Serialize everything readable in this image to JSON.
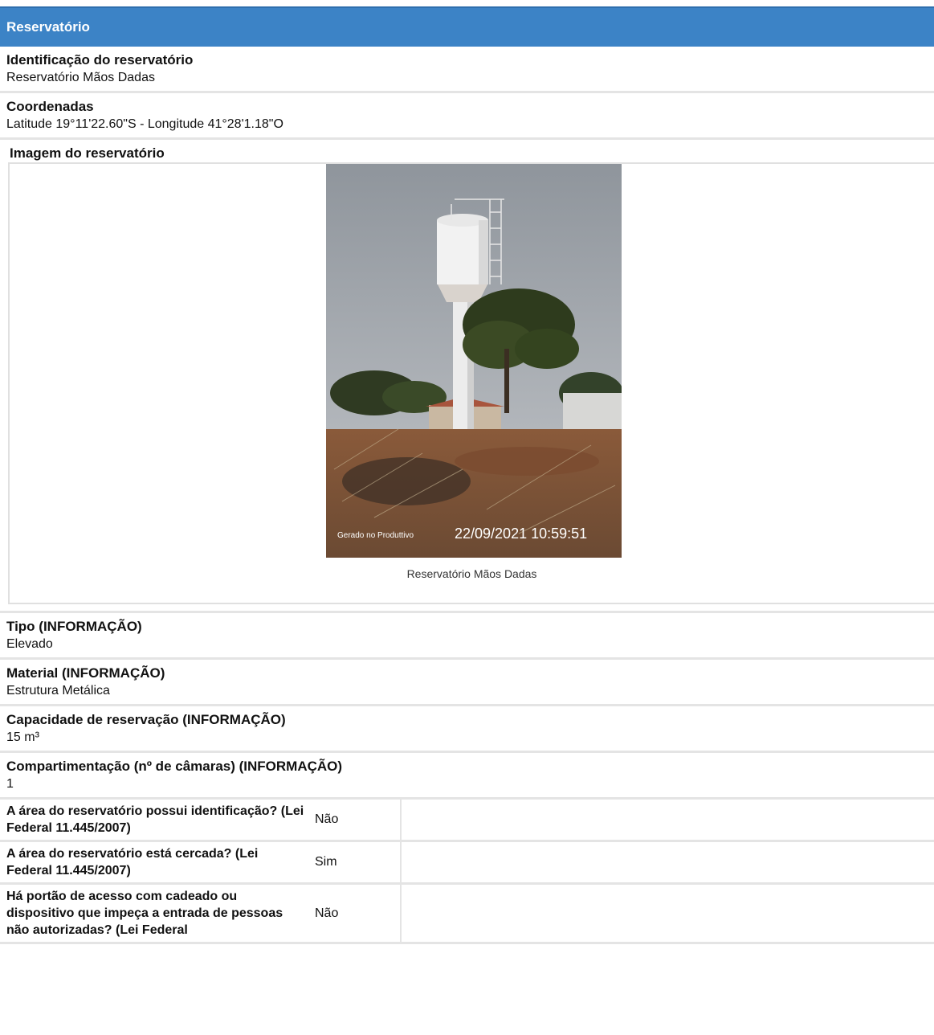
{
  "section": {
    "title": "Reservatório"
  },
  "fields": {
    "identificacao": {
      "label": "Identificação do reservatório",
      "value": "Reservatório Mãos Dadas"
    },
    "coordenadas": {
      "label": "Coordenadas",
      "value": "Latitude 19°11'22.60\"S - Longitude 41°28'1.18\"O"
    },
    "imagem": {
      "label": "Imagem do reservatório",
      "caption": "Reservatório Mãos Dadas",
      "watermark": "Gerado no Produttivo",
      "timestamp": "22/09/2021 10:59:51"
    },
    "tipo": {
      "label": "Tipo (INFORMAÇÃO)",
      "value": "Elevado"
    },
    "material": {
      "label": "Material (INFORMAÇÃO)",
      "value": "Estrutura Metálica"
    },
    "capacidade": {
      "label": "Capacidade de reservação (INFORMAÇÃO)",
      "value": "15 m³"
    },
    "compartimentacao": {
      "label": "Compartimentação (nº de câmaras) (INFORMAÇÃO)",
      "value": "1"
    }
  },
  "questions": [
    {
      "question": "A área do reservatório possui identificação? (Lei Federal 11.445/2007)",
      "answer": "Não"
    },
    {
      "question": "A área do reservatório está cercada? (Lei Federal 11.445/2007)",
      "answer": "Sim"
    },
    {
      "question": "Há portão de acesso com cadeado ou dispositivo que impeça a entrada de pessoas não autorizadas? (Lei Federal",
      "answer": "Não"
    }
  ]
}
